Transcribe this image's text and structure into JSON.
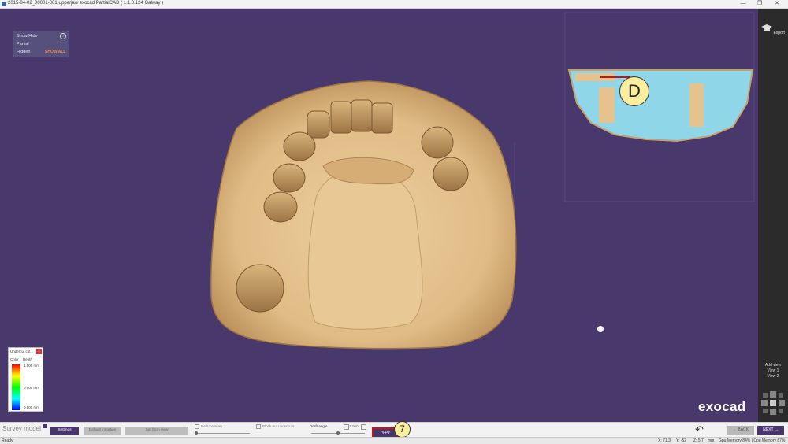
{
  "titlebar": {
    "title": "2015-04-02_00001-001-upperjaw exocad PartialCAD ( 1.1.0.124 Galway )",
    "minimize": "—",
    "maximize": "❐",
    "close": "✕"
  },
  "layer_panel": {
    "showhide": "Show/Hide",
    "partial": "Partial",
    "hidden": "Hidden",
    "show_all": "SHOW ALL",
    "help": "?"
  },
  "legend": {
    "title": "Undercut col...",
    "close": "×",
    "col_color": "Color",
    "col_depth": "Depth",
    "top_value": "1.000",
    "mid_value": "0.500",
    "bottom_value": "0.000",
    "unit": "mm"
  },
  "badge_d": "D",
  "badge_7": "7",
  "logo": "exocad",
  "rightbar": {
    "export": "Export",
    "add_view": "Add view",
    "view1": "View 1",
    "view2": "View 2"
  },
  "bottom": {
    "step_title": "Survey model",
    "settings": "Settings",
    "default_insertion": "Default insertion",
    "set_from_view": "Set from view",
    "reduce_scan": "Reduce scan",
    "block_out": "Block out undercuts",
    "draft_angle": "Draft angle",
    "draft_value": "2.000",
    "apply": "Apply",
    "back": "BACK",
    "next": "NEXT",
    "undo": "↶"
  },
  "status": {
    "ready": "Ready",
    "x": "X: 71.3",
    "y": "Y: -52",
    "z": "Z: 5.7",
    "unit": "mm",
    "gpu": "Gpu Memory 84% | Cpu Memory 87%"
  },
  "colors": {
    "background": "#48386b",
    "model": "#e6c38e",
    "accent": "#47356b",
    "badge": "#fbee9c",
    "apply_border": "#d01010"
  },
  "icons": [
    "graduation-cap-icon",
    "undo-icon",
    "arrow-left-icon",
    "arrow-right-icon",
    "view-cube-icon",
    "help-icon",
    "close-icon"
  ]
}
